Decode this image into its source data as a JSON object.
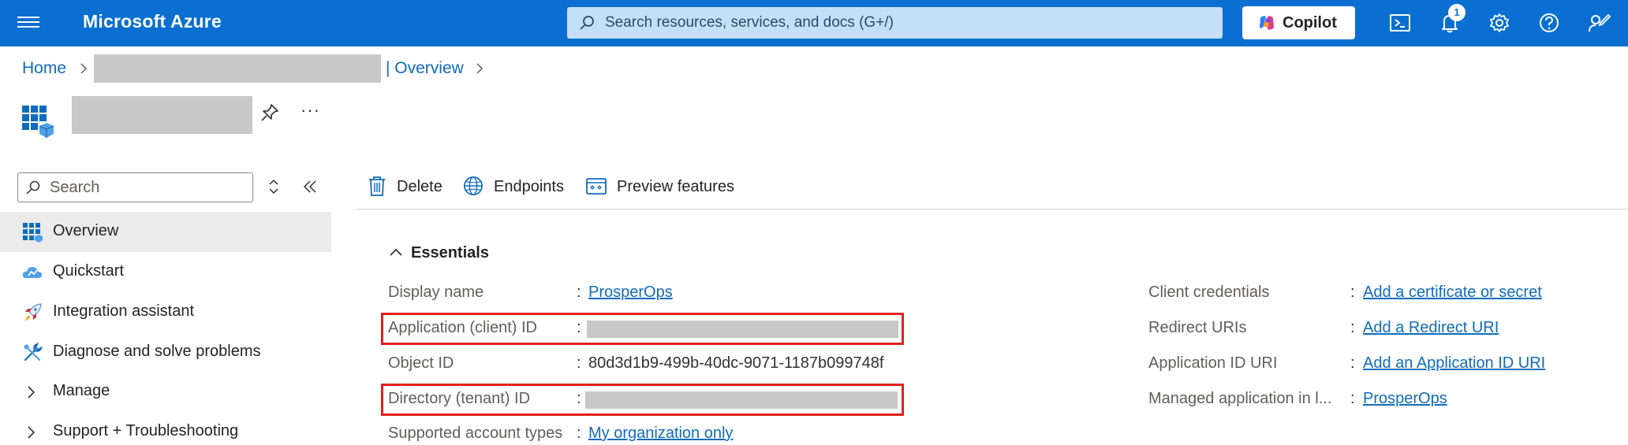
{
  "topbar": {
    "brand": "Microsoft Azure",
    "search_placeholder": "Search resources, services, and docs (G+/)",
    "copilot_label": "Copilot",
    "notification_count": "1",
    "colors": {
      "bar": "#0a6fd0",
      "search_bg": "#c5dff7"
    },
    "icons": [
      "hamburger-icon",
      "search-icon",
      "copilot-icon",
      "cloud-shell-icon",
      "bell-icon",
      "gear-icon",
      "help-icon",
      "feedback-icon"
    ]
  },
  "breadcrumb": {
    "home": "Home",
    "current": "| Overview"
  },
  "resource": {
    "icons": [
      "app-registration-icon",
      "pin-icon"
    ],
    "more_label": "···"
  },
  "nav": {
    "search_placeholder": "Search",
    "items": [
      {
        "label": "Overview",
        "icon": "overview-icon",
        "active": true
      },
      {
        "label": "Quickstart",
        "icon": "quickstart-cloud-icon"
      },
      {
        "label": "Integration assistant",
        "icon": "rocket-icon"
      },
      {
        "label": "Diagnose and solve problems",
        "icon": "wrench-icon"
      },
      {
        "label": "Manage",
        "icon": "chevron-right-icon"
      },
      {
        "label": "Support + Troubleshooting",
        "icon": "chevron-right-icon"
      }
    ]
  },
  "commands": {
    "delete": "Delete",
    "endpoints": "Endpoints",
    "preview": "Preview features"
  },
  "essentials": {
    "title": "Essentials",
    "colon": ":",
    "left": [
      {
        "label": "Display name",
        "value": "ProsperOps",
        "type": "link"
      },
      {
        "label": "Application (client) ID",
        "value": "",
        "type": "redacted",
        "highlighted": true
      },
      {
        "label": "Object ID",
        "value": "80d3d1b9-499b-40dc-9071-1187b099748f",
        "type": "text"
      },
      {
        "label": "Directory (tenant) ID",
        "value": "",
        "type": "redacted",
        "highlighted": true
      },
      {
        "label": "Supported account types",
        "value": "My organization only",
        "type": "link"
      }
    ],
    "right": [
      {
        "label": "Client credentials",
        "value": "Add a certificate or secret",
        "type": "link"
      },
      {
        "label": "Redirect URIs",
        "value": "Add a Redirect URI",
        "type": "link"
      },
      {
        "label": "Application ID URI",
        "value": "Add an Application ID URI",
        "type": "link"
      },
      {
        "label": "Managed application in l...",
        "value": "ProsperOps",
        "type": "link"
      }
    ],
    "highlight_color": "#e3201b"
  }
}
